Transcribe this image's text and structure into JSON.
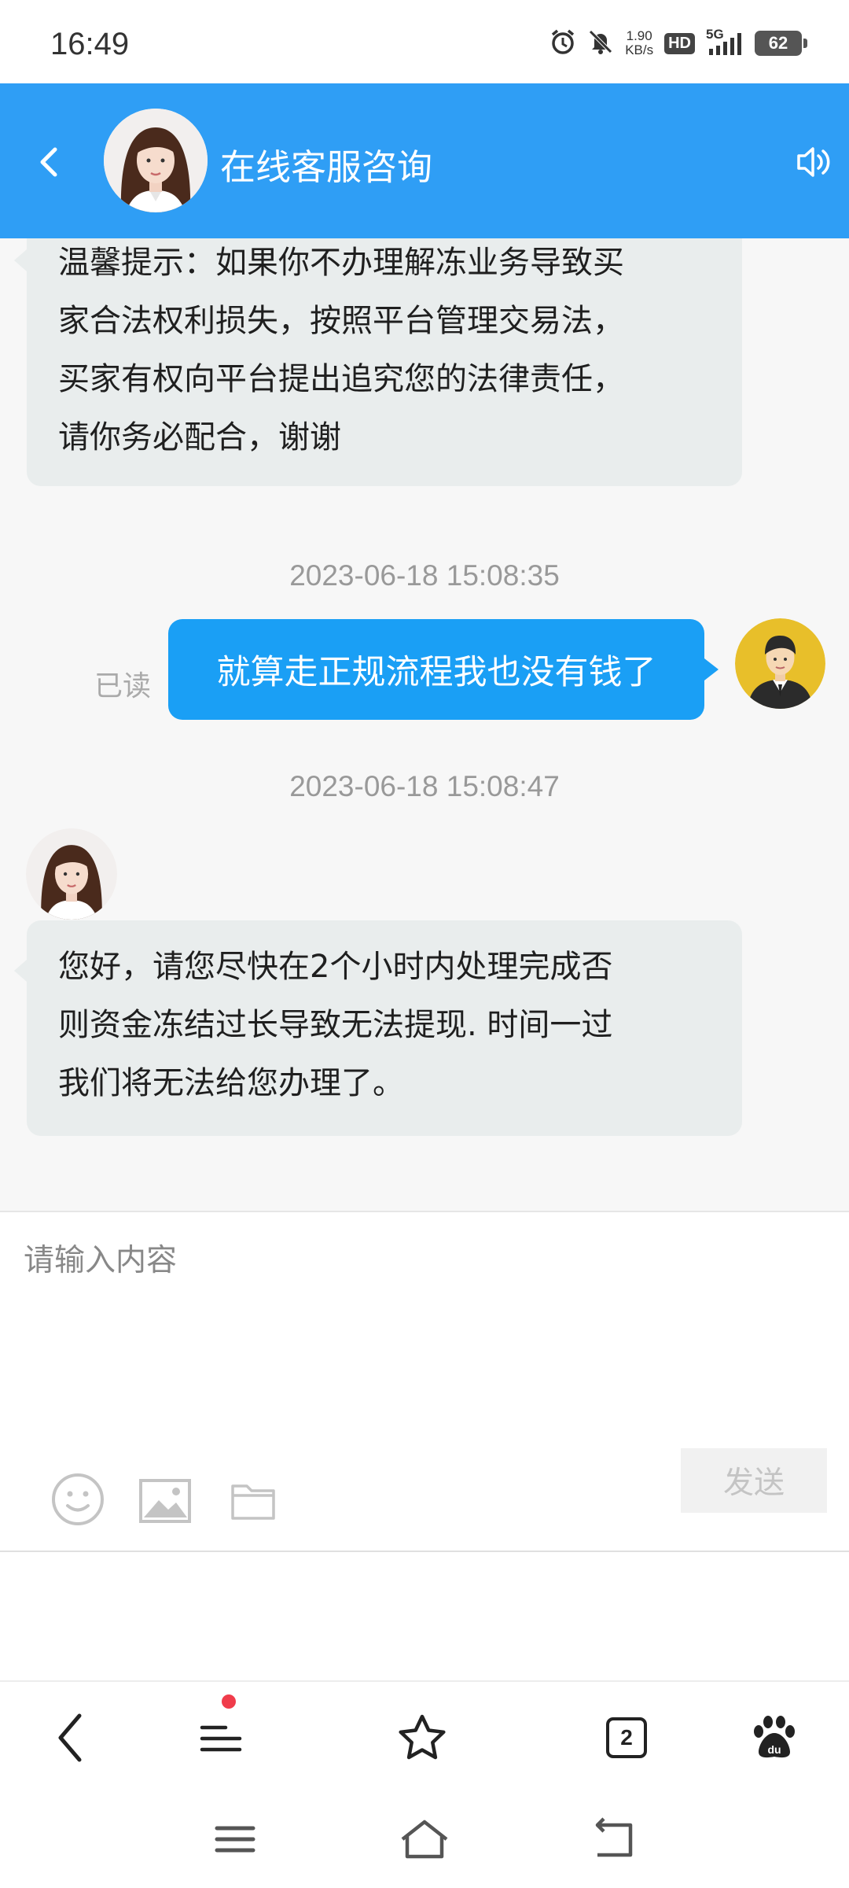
{
  "status_bar": {
    "time": "16:49",
    "net_speed_value": "1.90",
    "net_speed_unit": "KB/s",
    "hd_label": "HD",
    "network_label": "5G",
    "battery": "62",
    "icons": [
      "alarm-icon",
      "mute-icon",
      "signal-icon"
    ]
  },
  "header": {
    "title": "在线客服咨询",
    "icons": [
      "back-arrow-icon",
      "speaker-icon"
    ]
  },
  "messages": [
    {
      "side": "left",
      "text_lines": [
        "温馨提示：如果你不办理解冻业务导致买",
        "家合法权利损失，按照平台管理交易法，",
        "买家有权向平台提出追究您的法律责任，",
        "请你务必配合，谢谢"
      ]
    },
    {
      "timestamp": "2023-06-18 15:08:35"
    },
    {
      "side": "right",
      "status": "已读",
      "text": "就算走正规流程我也没有钱了"
    },
    {
      "timestamp": "2023-06-18 15:08:47"
    },
    {
      "side": "left",
      "text_lines": [
        "您好，请您尽快在2个小时内处理完成否",
        "则资金冻结过长导致无法提现. 时间一过",
        "我们将无法给您办理了。"
      ]
    }
  ],
  "input": {
    "placeholder": "请输入内容",
    "value": "",
    "send_label": "发送",
    "tools": [
      "emoji-icon",
      "image-icon",
      "folder-icon"
    ]
  },
  "browser_bar": {
    "tab_count": "2",
    "icons": [
      "back-icon",
      "menu-icon",
      "star-icon",
      "tabs-icon",
      "baidu-icon"
    ]
  },
  "system_nav": {
    "icons": [
      "recent-apps-icon",
      "home-icon",
      "return-icon"
    ]
  }
}
